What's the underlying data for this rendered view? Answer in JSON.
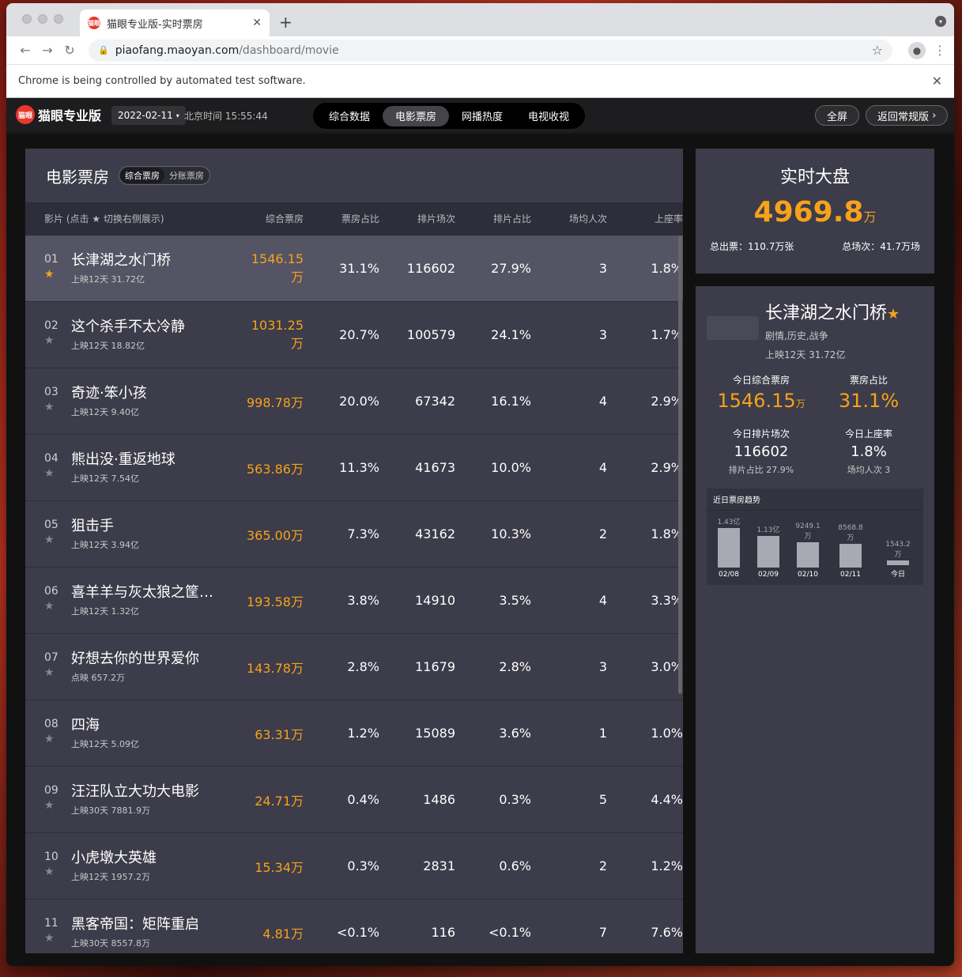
{
  "browser": {
    "tab_title": "猫眼专业版-实时票房",
    "tab_favicon": "猫眼",
    "url_host": "piaofang.maoyan.com",
    "url_path": "/dashboard/movie",
    "infobar_text": "Chrome is being controlled by automated test software."
  },
  "header": {
    "logo_text": "猫眼专业版",
    "logo_mark": "猫眼",
    "date": "2022-02-11",
    "clock": "北京时间 15:55:44",
    "nav": [
      "综合数据",
      "电影票房",
      "网播热度",
      "电视收视"
    ],
    "nav_active": 1,
    "btn_fullscreen": "全屏",
    "btn_back": "返回常规版"
  },
  "boxoffice": {
    "title": "电影票房",
    "seg": [
      "综合票房",
      "分账票房"
    ],
    "columns": [
      "影片 (点击 ★ 切换右侧展示)",
      "综合票房",
      "票房占比",
      "排片场次",
      "排片占比",
      "场均人次",
      "上座率"
    ],
    "rows": [
      {
        "rank": "01",
        "name": "长津湖之水门桥",
        "sub": "上映12天  31.72亿",
        "box": "1546.15万",
        "box_pct": "31.1%",
        "shows": "116602",
        "show_pct": "27.9%",
        "avg": "3",
        "seat": "1.8%",
        "starred": true
      },
      {
        "rank": "02",
        "name": "这个杀手不太冷静",
        "sub": "上映12天  18.82亿",
        "box": "1031.25万",
        "box_pct": "20.7%",
        "shows": "100579",
        "show_pct": "24.1%",
        "avg": "3",
        "seat": "1.7%",
        "starred": false
      },
      {
        "rank": "03",
        "name": "奇迹·笨小孩",
        "sub": "上映12天  9.40亿",
        "box": "998.78万",
        "box_pct": "20.0%",
        "shows": "67342",
        "show_pct": "16.1%",
        "avg": "4",
        "seat": "2.9%",
        "starred": false
      },
      {
        "rank": "04",
        "name": "熊出没·重返地球",
        "sub": "上映12天  7.54亿",
        "box": "563.86万",
        "box_pct": "11.3%",
        "shows": "41673",
        "show_pct": "10.0%",
        "avg": "4",
        "seat": "2.9%",
        "starred": false
      },
      {
        "rank": "05",
        "name": "狙击手",
        "sub": "上映12天  3.94亿",
        "box": "365.00万",
        "box_pct": "7.3%",
        "shows": "43162",
        "show_pct": "10.3%",
        "avg": "2",
        "seat": "1.8%",
        "starred": false
      },
      {
        "rank": "06",
        "name": "喜羊羊与灰太狼之筐…",
        "sub": "上映12天  1.32亿",
        "box": "193.58万",
        "box_pct": "3.8%",
        "shows": "14910",
        "show_pct": "3.5%",
        "avg": "4",
        "seat": "3.3%",
        "starred": false
      },
      {
        "rank": "07",
        "name": "好想去你的世界爱你",
        "sub": "点映  657.2万",
        "box": "143.78万",
        "box_pct": "2.8%",
        "shows": "11679",
        "show_pct": "2.8%",
        "avg": "3",
        "seat": "3.0%",
        "starred": false
      },
      {
        "rank": "08",
        "name": "四海",
        "sub": "上映12天  5.09亿",
        "box": "63.31万",
        "box_pct": "1.2%",
        "shows": "15089",
        "show_pct": "3.6%",
        "avg": "1",
        "seat": "1.0%",
        "starred": false
      },
      {
        "rank": "09",
        "name": "汪汪队立大功大电影",
        "sub": "上映30天  7881.9万",
        "box": "24.71万",
        "box_pct": "0.4%",
        "shows": "1486",
        "show_pct": "0.3%",
        "avg": "5",
        "seat": "4.4%",
        "starred": false
      },
      {
        "rank": "10",
        "name": "小虎墩大英雄",
        "sub": "上映12天  1957.2万",
        "box": "15.34万",
        "box_pct": "0.3%",
        "shows": "2831",
        "show_pct": "0.6%",
        "avg": "2",
        "seat": "1.2%",
        "starred": false
      },
      {
        "rank": "11",
        "name": "黑客帝国：矩阵重启",
        "sub": "上映30天  8557.8万",
        "box": "4.81万",
        "box_pct": "<0.1%",
        "shows": "116",
        "show_pct": "<0.1%",
        "avg": "7",
        "seat": "7.6%",
        "starred": false
      }
    ]
  },
  "realtime": {
    "title": "实时大盘",
    "total": "4969.8",
    "unit": "万",
    "tickets": "总出票：110.7万张",
    "shows": "总场次：41.7万场"
  },
  "detail": {
    "title": "长津湖之水门桥",
    "genre": "剧情,历史,战争",
    "release": "上映12天  31.72亿",
    "stats": [
      {
        "label": "今日综合票房",
        "value": "1546.15",
        "unit": "万"
      },
      {
        "label": "票房占比",
        "value": "31.1%"
      },
      {
        "label": "今日排片场次",
        "value": "116602",
        "sub": "排片占比 27.9%"
      },
      {
        "label": "今日上座率",
        "value": "1.8%",
        "sub": "场均人次 3"
      }
    ],
    "trend_title": "近日票房趋势",
    "trend": [
      {
        "label": "02/08",
        "value_text": "1.43亿",
        "value": 14300
      },
      {
        "label": "02/09",
        "value_text": "1.13亿",
        "value": 11300
      },
      {
        "label": "02/10",
        "value_text": "9249.1万",
        "value": 9249.1
      },
      {
        "label": "02/11",
        "value_text": "8568.8万",
        "value": 8568.8
      },
      {
        "label": "今日",
        "value_text": "1543.2万",
        "value": 1543.2
      }
    ]
  },
  "colors": {
    "accent": "#f7a21b",
    "panel": "#3c3c4a",
    "brand": "#e8372b"
  }
}
